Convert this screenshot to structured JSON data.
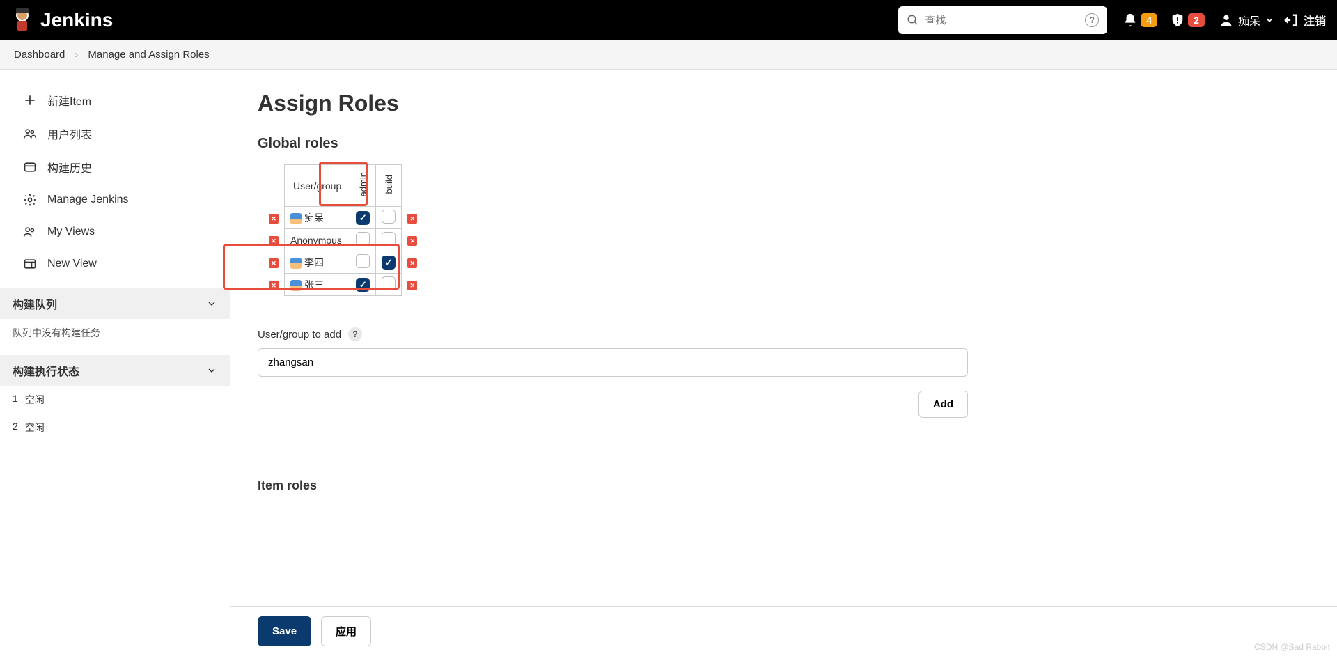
{
  "header": {
    "brand": "Jenkins",
    "search_placeholder": "查找",
    "notif_count": "4",
    "alert_count": "2",
    "username": "痴呆",
    "logout": "注销"
  },
  "breadcrumb": {
    "items": [
      "Dashboard",
      "Manage and Assign Roles"
    ]
  },
  "sidebar": {
    "items": [
      {
        "label": "新建Item"
      },
      {
        "label": "用户列表"
      },
      {
        "label": "构建历史"
      },
      {
        "label": "Manage Jenkins"
      },
      {
        "label": "My Views"
      },
      {
        "label": "New View"
      }
    ],
    "queue_title": "构建队列",
    "queue_empty": "队列中没有构建任务",
    "exec_title": "构建执行状态",
    "executors": [
      {
        "num": "1",
        "state": "空闲"
      },
      {
        "num": "2",
        "state": "空闲"
      }
    ]
  },
  "main": {
    "title": "Assign Roles",
    "global_section": "Global roles",
    "table": {
      "header_user": "User/group",
      "roles": [
        "admin",
        "build"
      ],
      "rows": [
        {
          "name": "痴呆",
          "show_icon": true,
          "admin": true,
          "build": false
        },
        {
          "name": "Anonymous",
          "show_icon": false,
          "admin": false,
          "build": false
        },
        {
          "name": "李四",
          "show_icon": true,
          "admin": false,
          "build": true
        },
        {
          "name": "张三",
          "show_icon": true,
          "admin": true,
          "build": false
        }
      ]
    },
    "add_label": "User/group to add",
    "add_value": "zhangsan",
    "add_button": "Add",
    "item_section": "Item roles",
    "save": "Save",
    "apply": "应用"
  },
  "watermark": "CSDN @Sad Rabbit"
}
